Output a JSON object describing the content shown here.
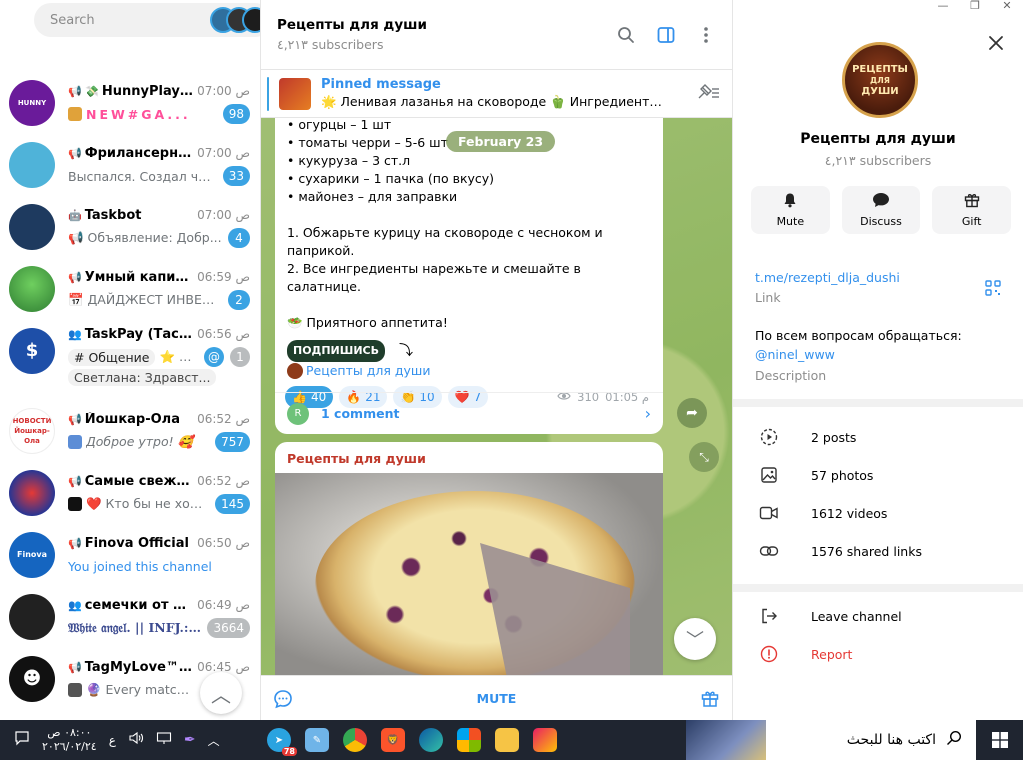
{
  "window": {
    "minimize": "—",
    "maximize": "❐",
    "close": "✕"
  },
  "sidebar": {
    "search_placeholder": "Search",
    "chats": [
      {
        "name": "HunnyPlay ...",
        "prefix": "📢 💸",
        "time": "07:00 ص",
        "preview": "NEW#GA...",
        "badge": "98",
        "avatar_color": "#6a1b9a",
        "avatar_text": "HUNNY",
        "preview_style": "fancy"
      },
      {
        "name": "Фрилансерная",
        "prefix": "📢",
        "time": "07:00 ص",
        "preview": "Выспался. Создал чат-б...",
        "badge": "33",
        "avatar_color": "#4fb3d9",
        "avatar_text": "",
        "preview_style": ""
      },
      {
        "name": "Taskbot",
        "prefix": "🤖",
        "time": "07:00 ص",
        "preview": "📢 Объявление: Добр...",
        "badge": "4",
        "avatar_color": "#1e3a5f",
        "avatar_text": "",
        "preview_style": ""
      },
      {
        "name": "Умный капитал",
        "prefix": "📢",
        "time": "06:59 ص",
        "preview": "📅 ДАЙДЖЕСТ ИНВЕСТ...",
        "badge": "2",
        "avatar_color": "#4caf50",
        "avatar_text": "",
        "preview_style": ""
      },
      {
        "name": "Йошкар-Ола",
        "prefix": "📢",
        "time": "06:52 ص",
        "preview": "Доброе утро! 🥰",
        "badge": "757",
        "avatar_color": "#d32f2f",
        "avatar_text": "НОВОСТИ Йошкар-Ола",
        "preview_style": "italic"
      },
      {
        "name": "Самые свежие ...",
        "prefix": "📢",
        "time": "06:52 ص",
        "preview": "❤️ Кто бы не хоте...",
        "badge": "145",
        "avatar_color": "#283593",
        "avatar_text": "",
        "preview_style": ""
      },
      {
        "name": "Finova Official",
        "prefix": "📢",
        "time": "06:50 ص",
        "preview": "You joined this channel",
        "badge": "",
        "avatar_color": "#1565c0",
        "avatar_text": "Finova",
        "preview_style": "blue"
      },
      {
        "name": "семечки от ма...",
        "prefix": "👥",
        "time": "06:49 ص",
        "preview": "𝔚𝔥𝔦𝔱𝔢 𝔞𝔫𝔤𝔢𝔩. || INFJ.: ...",
        "badge": "3664",
        "avatar_color": "#212121",
        "avatar_text": "",
        "preview_style": "gothic",
        "muted": true
      },
      {
        "name": "TagMyLove™ N...",
        "prefix": "📢",
        "time": "06:45 ص",
        "preview": "🔮 Every match cr...",
        "badge": "",
        "avatar_color": "#111111",
        "avatar_text": "",
        "preview_style": ""
      }
    ],
    "forum": {
      "name": "TaskPay (Таскп...",
      "prefix": "👥",
      "time": "06:56 ص",
      "topic": "# Общение",
      "topic_preview": "⭐ О...",
      "mention": "@",
      "badge": "1",
      "line3": "Светлана: Здравст...",
      "avatar_color": "#1e4fa8"
    },
    "scroll_up": "︿"
  },
  "chat": {
    "title": "Рецепты для души",
    "subscribers": "٤,٢١٣ subscribers",
    "pinned_label": "Pinned message",
    "pinned_text": "🌟 Ленивая лазанья на сковороде 🫑 Ингредиенты: ...",
    "date_pill": "February 23",
    "message_lines": [
      "• огурцы – 1 шт",
      "• томаты черри – 5-6 шт",
      "• кукуруза – 3 ст.л",
      "• сухарики – 1 пачка (по вкусу)",
      "• майонез – для заправки",
      "",
      "1. Обжарьте курицу на сковороде с чесноком и паприкой.",
      "2. Все ингредиенты нарежьте и смешайте в салатнице.",
      "",
      "🥗 Приятного аппетита!"
    ],
    "subscribe_sticker": "ПОДПИШИСЬ",
    "channel_link": "Рецепты для души",
    "reactions": [
      {
        "emoji": "👍",
        "count": "40",
        "active": true
      },
      {
        "emoji": "🔥",
        "count": "21",
        "active": false
      },
      {
        "emoji": "👏",
        "count": "10",
        "active": false
      },
      {
        "emoji": "❤️",
        "count": "7",
        "active": false
      }
    ],
    "views": "310",
    "time": "01:05 م",
    "comment_avatar": "R",
    "comment_label": "1 comment",
    "second_author": "Рецепты для души",
    "mute_label": "MUTE"
  },
  "info": {
    "avatar_text_1": "РЕЦЕПТЫ",
    "avatar_text_2": "ДЛЯ",
    "avatar_text_3": "ДУШИ",
    "name": "Рецепты для души",
    "subscribers": "٤,٢١٣ subscribers",
    "actions": {
      "mute": "Mute",
      "discuss": "Discuss",
      "gift": "Gift"
    },
    "link": "t.me/rezepti_dlja_dushi",
    "link_label": "Link",
    "description": "По всем вопросам обращаться:",
    "description_mention": "@ninel_www",
    "description_label": "Description",
    "media": {
      "posts": "2 posts",
      "photos": "57 photos",
      "videos": "1612 videos",
      "links": "1576 shared links"
    },
    "leave": "Leave channel",
    "report": "Report"
  },
  "taskbar": {
    "time": "٠٨:٠٠ ص",
    "date": "٢٠٢٦/٠٢/٢٤",
    "lang": "ع",
    "telegram_badge": "78",
    "search_text": "اكتب هنا للبحث"
  },
  "colors": {
    "accent": "#3390ec",
    "badge": "#3aa3e3",
    "danger": "#e53935",
    "chat_bg": "#9ebc6b"
  }
}
